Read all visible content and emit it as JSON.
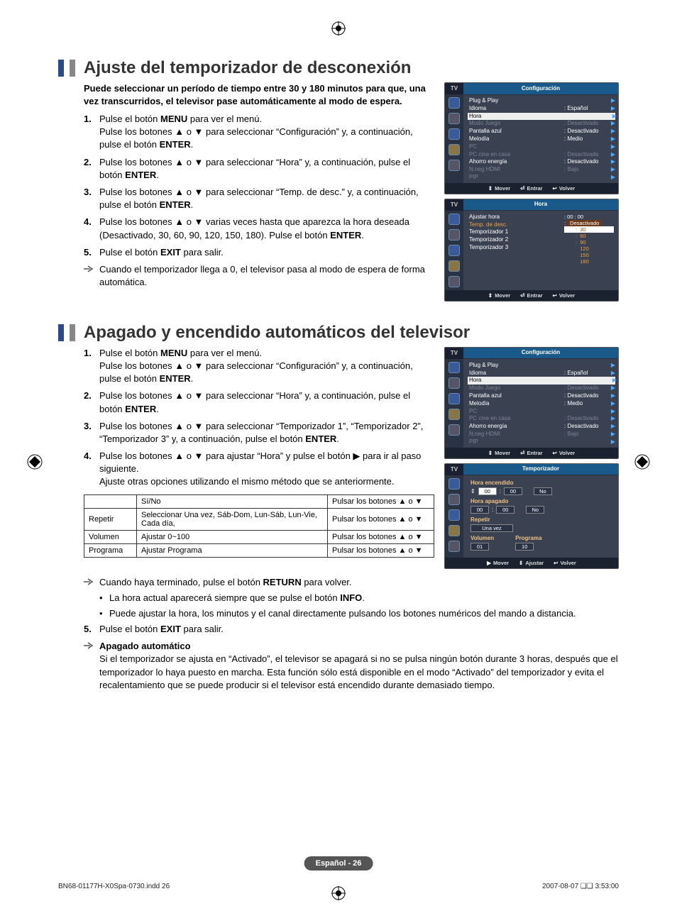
{
  "section1": {
    "title": "Ajuste del temporizador de desconexión",
    "intro": "Puede seleccionar un período de tiempo entre 30 y 180 minutos para que, una vez transcurridos, el televisor pase automáticamente al modo de espera.",
    "steps": [
      "Pulse el botón MENU para ver el menú.\nPulse los botones ▲ o ▼ para seleccionar “Configuración” y, a continuación, pulse el botón ENTER.",
      "Pulse los botones ▲ o ▼ para seleccionar “Hora” y, a continuación, pulse el botón ENTER.",
      "Pulse los botones ▲ o ▼ para seleccionar “Temp. de desc.” y, a continuación, pulse el botón ENTER.",
      "Pulse los botones ▲ o ▼ varias veces hasta que aparezca la hora deseada (Desactivado, 30, 60, 90, 120, 150, 180). Pulse el botón ENTER.",
      "Pulse el botón EXIT para salir."
    ],
    "note": "Cuando el temporizador llega a 0, el televisor pasa al modo de espera de forma automática."
  },
  "section2": {
    "title": "Apagado y encendido automáticos del televisor",
    "steps": [
      "Pulse el botón MENU para ver el menú.\nPulse los botones ▲ o ▼ para seleccionar “Configuración” y, a continuación, pulse el botón ENTER.",
      "Pulse los botones ▲ o ▼ para seleccionar “Hora” y, a continuación, pulse el botón ENTER.",
      "Pulse los botones ▲ o ▼ para seleccionar “Temporizador 1”, “Temporizador 2”, “Temporizador 3” y, a continuación, pulse el botón ENTER.",
      "Pulse los botones ▲ o ▼ para ajustar “Hora” y pulse el botón ▶ para ir al paso siguiente.\nAjuste otras opciones utilizando el mismo método que se anteriormente."
    ],
    "table": {
      "rows": [
        {
          "c1": "",
          "c2": "Sí/No",
          "c3": "Pulsar los botones ▲ o ▼"
        },
        {
          "c1": "Repetir",
          "c2": "Seleccionar Una vez, Sáb-Dom, Lun-Sáb, Lun-Vie, Cada día,",
          "c3": "Pulsar los botones ▲ o ▼"
        },
        {
          "c1": "Volumen",
          "c2": "Ajustar 0~100",
          "c3": "Pulsar los botones ▲ o ▼"
        },
        {
          "c1": "Programa",
          "c2": "Ajustar Programa",
          "c3": "Pulsar los botones ▲ o ▼"
        }
      ]
    },
    "note1": "Cuando haya terminado, pulse el botón RETURN para volver.",
    "bullets": [
      "La hora actual aparecerá siempre que se pulse el botón INFO.",
      "Puede ajustar la hora, los minutos y el canal directamente pulsando los botones numéricos del mando a distancia."
    ],
    "step5": "Pulse el botón EXIT para salir.",
    "auto_title": "Apagado automático",
    "auto_body": "Si el temporizador se ajusta en “Activado”, el televisor se apagará si no se pulsa ningún botón durante 3 horas, después que el temporizador lo haya puesto en marcha. Esta función sólo está disponible en el modo “Activado” del temporizador y evita el recalentamiento que se puede producir si el televisor está encendido durante demasiado tiempo."
  },
  "osd_config": {
    "tv": "TV",
    "title": "Configuración",
    "rows": [
      {
        "lbl": "Plug & Play",
        "val": "",
        "dim": false,
        "arr": true
      },
      {
        "lbl": "Idioma",
        "val": ": Español",
        "dim": false,
        "arr": true
      },
      {
        "lbl": "Hora",
        "val": "",
        "dim": false,
        "arr": true,
        "hl": true
      },
      {
        "lbl": "Modo Juego",
        "val": ": Desactivado",
        "dim": true,
        "arr": true
      },
      {
        "lbl": "Pantalla azul",
        "val": ": Desactivado",
        "dim": false,
        "arr": true
      },
      {
        "lbl": "Melodía",
        "val": ": Medio",
        "dim": false,
        "arr": true
      },
      {
        "lbl": "PC",
        "val": "",
        "dim": true,
        "arr": true
      },
      {
        "lbl": "PC cine en casa",
        "val": ": Desactivado",
        "dim": true,
        "arr": true
      },
      {
        "lbl": "Ahorro energía",
        "val": ": Desactivado",
        "dim": false,
        "arr": true
      },
      {
        "lbl": "N.neg HDMI",
        "val": ": Bajo",
        "dim": true,
        "arr": true
      },
      {
        "lbl": "PIP",
        "val": "",
        "dim": true,
        "arr": true
      }
    ],
    "foot": {
      "a": "Mover",
      "b": "Entrar",
      "c": "Volver"
    }
  },
  "osd_hora": {
    "tv": "TV",
    "title": "Hora",
    "rows": [
      {
        "lbl": "Ajustar hora",
        "val": ": 00 : 00"
      },
      {
        "lbl": "Temp. de desc.",
        "val": ": Desactivado",
        "hl": true
      }
    ],
    "timers": [
      "Temporizador 1",
      "Temporizador 2",
      "Temporizador 3"
    ],
    "options": [
      "30",
      "60",
      "90",
      "120",
      "150",
      "180"
    ],
    "foot": {
      "a": "Mover",
      "b": "Entrar",
      "c": "Volver"
    }
  },
  "osd_timer": {
    "tv": "TV",
    "title": "Temporizador",
    "on_lbl": "Hora encendido",
    "off_lbl": "Hora apagado",
    "hh": "00",
    "mm": "00",
    "no": "No",
    "rep_lbl": "Repetir",
    "rep_val": "Una vez",
    "vol_lbl": "Volumen",
    "vol_val": "01",
    "prg_lbl": "Programa",
    "prg_val": "10",
    "foot": {
      "a": "Mover",
      "b": "Ajustar",
      "c": "Volver"
    }
  },
  "footer": {
    "badge": "Español - 26",
    "left": "BN68-01177H-X0Spa-0730.indd   26",
    "right": "2007-08-07   ❑❑ 3:53:00"
  }
}
